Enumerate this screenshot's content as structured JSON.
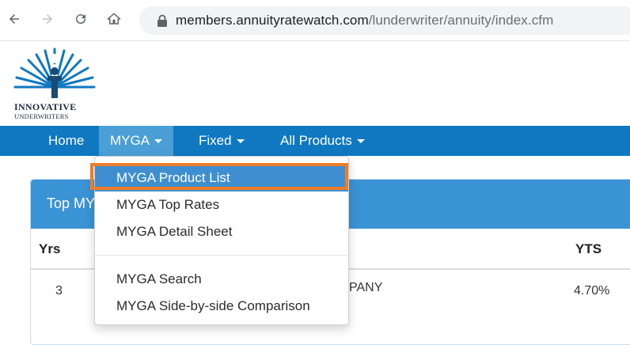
{
  "browser": {
    "url_domain": "members.annuityratewatch.com",
    "url_path": "/lunderwriter/annuity/index.cfm"
  },
  "logo": {
    "line1": "INNOVATIVE",
    "line2": "UNDERWRITERS"
  },
  "navbar": {
    "items": [
      {
        "label": "Home"
      },
      {
        "label": "MYGA"
      },
      {
        "label": "Fixed"
      },
      {
        "label": "All Products"
      }
    ]
  },
  "panel": {
    "title": "Top MY",
    "col_yrs": "Yrs",
    "col_yts": "YTS",
    "row1_yrs": "3",
    "row1_company": "PANY",
    "row1_yts": "4.70%"
  },
  "dropdown": {
    "items": [
      {
        "label": "MYGA Product List"
      },
      {
        "label": "MYGA Top Rates"
      },
      {
        "label": "MYGA Detail Sheet"
      },
      {
        "label": "MYGA Search"
      },
      {
        "label": "MYGA Side-by-side Comparison"
      }
    ]
  },
  "colors": {
    "navbar": "#0f78c1",
    "active_nav": "#4a9fd6",
    "highlight": "#3f8fd0",
    "annotation": "#f07c27"
  }
}
